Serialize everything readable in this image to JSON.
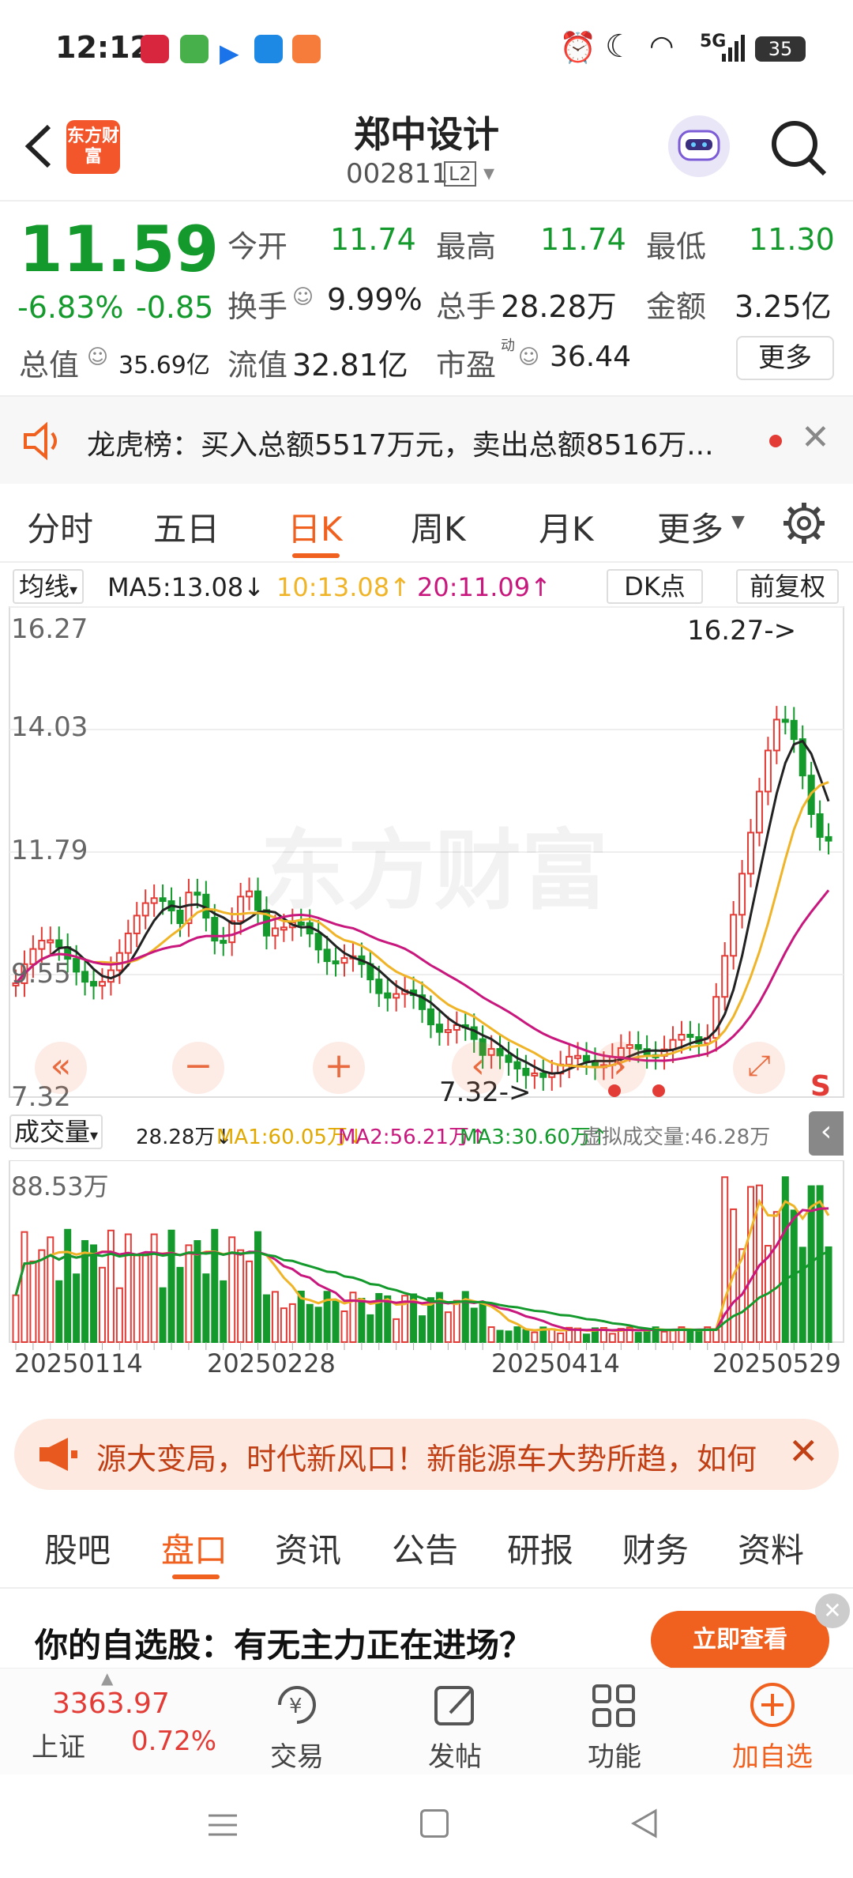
{
  "status_bar": {
    "time": "12:12",
    "battery": "35",
    "network": "5G"
  },
  "header": {
    "stock_name": "郑中设计",
    "stock_code": "002811",
    "level_badge": "L2",
    "logo_text": "东方财富"
  },
  "quote": {
    "price": "11.59",
    "change_pct": "-6.83%",
    "change": "-0.85",
    "open_label": "今开",
    "open": "11.74",
    "high_label": "最高",
    "high": "11.74",
    "low_label": "最低",
    "low": "11.30",
    "turnover_label": "换手",
    "turnover": "9.99%",
    "volume_label": "总手",
    "volume": "28.28万",
    "amount_label": "金额",
    "amount": "3.25亿",
    "mktcap_label": "总值",
    "mktcap": "35.69亿",
    "float_label": "流值",
    "float_cap": "32.81亿",
    "pe_label": "市盈",
    "pe_sup": "动",
    "pe": "36.44",
    "more_button": "更多"
  },
  "lhb": {
    "text": "龙虎榜：买入总额5517万元，卖出总额8516万..."
  },
  "chart_tabs": [
    "分时",
    "五日",
    "日K",
    "周K",
    "月K",
    "更多"
  ],
  "active_tab": "日K",
  "kline": {
    "ma_selector": "均线",
    "ma5": "MA5:13.08↓",
    "ma10": "10:13.08↑",
    "ma20": "20:11.09↑",
    "dk_button": "DK点",
    "adjust_button": "前复权",
    "price_labels": [
      "16.27",
      "14.03",
      "11.79",
      "9.55",
      "7.32"
    ],
    "high_marker": "16.27->",
    "low_marker": "7.32->",
    "watermark": "东方财富",
    "sell_marker": "S",
    "vol_selector": "成交量",
    "vol_value": "28.28万↓",
    "vol_ma1": "MA1:60.05万↓",
    "vol_ma2": "MA2:56.21万↑",
    "vol_ma3": "MA3:30.60万↑",
    "vol_virtual": "虚拟成交量:46.28万",
    "vol_max": "88.53万",
    "dates": [
      "20250114",
      "20250228",
      "20250414",
      "20250529"
    ]
  },
  "ticker": {
    "text": "源大变局，时代新风口！新能源车大势所趋，如何"
  },
  "bottom_tabs": [
    "股吧",
    "盘口",
    "资讯",
    "公告",
    "研报",
    "财务",
    "资料"
  ],
  "active_bottom_tab": "盘口",
  "ad": {
    "text": "你的自选股：有无主力正在进场？",
    "button": "立即查看"
  },
  "bottom_nav": {
    "index_value": "3363.97",
    "index_name": "上证",
    "index_change": "0.72%",
    "trade": "交易",
    "post": "发帖",
    "func": "功能",
    "add": "加自选"
  },
  "colors": {
    "up": "#e33b36",
    "down": "#149a2c",
    "accent": "#f0601e",
    "ma5": "#222222",
    "ma10": "#f0b429",
    "ma20": "#c8177d"
  }
}
